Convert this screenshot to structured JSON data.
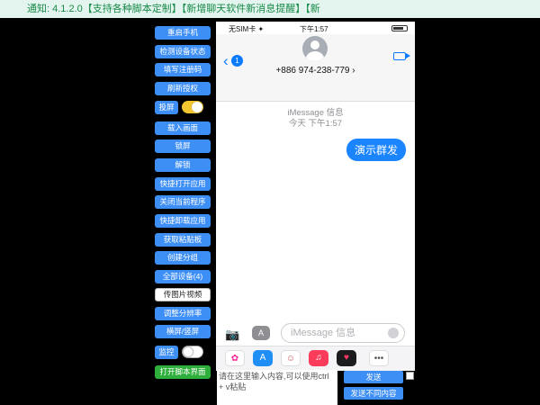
{
  "notice": {
    "text": "通知:  4.1.2.0【支持各种脚本定制】【新增聊天软件新消息提醒】【新"
  },
  "sidebar": {
    "buttons": [
      {
        "label": "重启手机"
      },
      {
        "label": "检测设备状态"
      },
      {
        "label": "填写注册码"
      },
      {
        "label": "刷新授权"
      },
      {
        "label": "载入画面"
      },
      {
        "label": "锁屏"
      },
      {
        "label": "解锁"
      },
      {
        "label": "快捷打开应用"
      },
      {
        "label": "关闭当前程序"
      },
      {
        "label": "快捷卸载应用"
      },
      {
        "label": "获取粘贴板"
      },
      {
        "label": "创建分组"
      },
      {
        "label": "全部设备(4)"
      },
      {
        "label": "传图片视频"
      },
      {
        "label": "调整分辨率"
      },
      {
        "label": "横屏/竖屏"
      },
      {
        "label": "打开脚本界面"
      }
    ],
    "cast_label": "投屏",
    "cast_on": true,
    "monitor_label": "监控",
    "monitor_on": false
  },
  "phone": {
    "carrier": "无SIM卡 ✦",
    "time": "下午1:57",
    "back_badge": "1",
    "contact_number": "+886 974-238-779 ›",
    "meta_line1": "iMessage 信息",
    "meta_line2": "今天 下午1:57",
    "bubble_text": "演示群发",
    "input_placeholder": "iMessage 信息",
    "apps": [
      {
        "icon": "photos-icon",
        "color": "#ffffff"
      },
      {
        "icon": "appstore-icon",
        "color": "#1f8ff5"
      },
      {
        "icon": "memoji-icon",
        "color": "#ffffff"
      },
      {
        "icon": "music-icon",
        "color": "#fa3c5a"
      },
      {
        "icon": "heart-icon",
        "color": "#1c1c1e"
      },
      {
        "icon": "more-icon",
        "color": "#ffffff"
      }
    ]
  },
  "composer": {
    "placeholder": "请在这里输入内容,可以使用ctrl + v粘贴",
    "send_label": "发送",
    "send_diff_label": "发送不同内容"
  }
}
